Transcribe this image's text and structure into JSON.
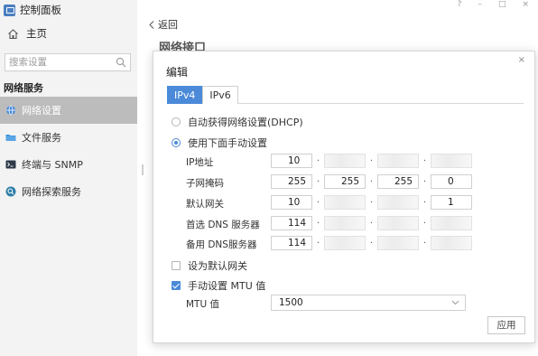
{
  "app": {
    "title": "控制面板"
  },
  "window_controls": {
    "help": "?",
    "minimize": "–",
    "maximize": "□",
    "close": "×"
  },
  "sidebar": {
    "home": "主页",
    "search_placeholder": "搜索设置",
    "section": "网络服务",
    "items": [
      {
        "label": "网络设置",
        "icon": "globe-icon",
        "active": true
      },
      {
        "label": "文件服务",
        "icon": "folder-icon",
        "active": false
      },
      {
        "label": "终端与 SNMP",
        "icon": "terminal-icon",
        "active": false
      },
      {
        "label": "网络探索服务",
        "icon": "search-circle-icon",
        "active": false
      }
    ]
  },
  "main": {
    "back_label": "返回",
    "page_title": "网络接口"
  },
  "dialog": {
    "title": "编辑",
    "close": "×",
    "tabs": [
      {
        "label": "IPv4",
        "active": true
      },
      {
        "label": "IPv6",
        "active": false
      }
    ],
    "option_dhcp": "自动获得网络设置(DHCP)",
    "option_manual": "使用下面手动设置",
    "fields": {
      "ip": {
        "label": "IP地址",
        "octets": [
          "10",
          "",
          "",
          ""
        ]
      },
      "mask": {
        "label": "子网掩码",
        "octets": [
          "255",
          "255",
          "255",
          "0"
        ]
      },
      "gateway": {
        "label": "默认网关",
        "octets": [
          "10",
          "",
          "",
          "1"
        ]
      },
      "dns1": {
        "label": "首选 DNS 服务器",
        "octets": [
          "114",
          "",
          "",
          ""
        ]
      },
      "dns2": {
        "label": "备用 DNS服务器",
        "octets": [
          "114",
          "",
          "",
          ""
        ]
      }
    },
    "default_gateway_checkbox": "设为默认网关",
    "mtu_checkbox": "手动设置 MTU 值",
    "mtu_label": "MTU 值",
    "mtu_value": "1500",
    "apply": "应用"
  },
  "colors": {
    "accent": "#4a8ad8",
    "sidebar_bg": "#f3f3f3",
    "active_item": "#bcbcbc"
  }
}
